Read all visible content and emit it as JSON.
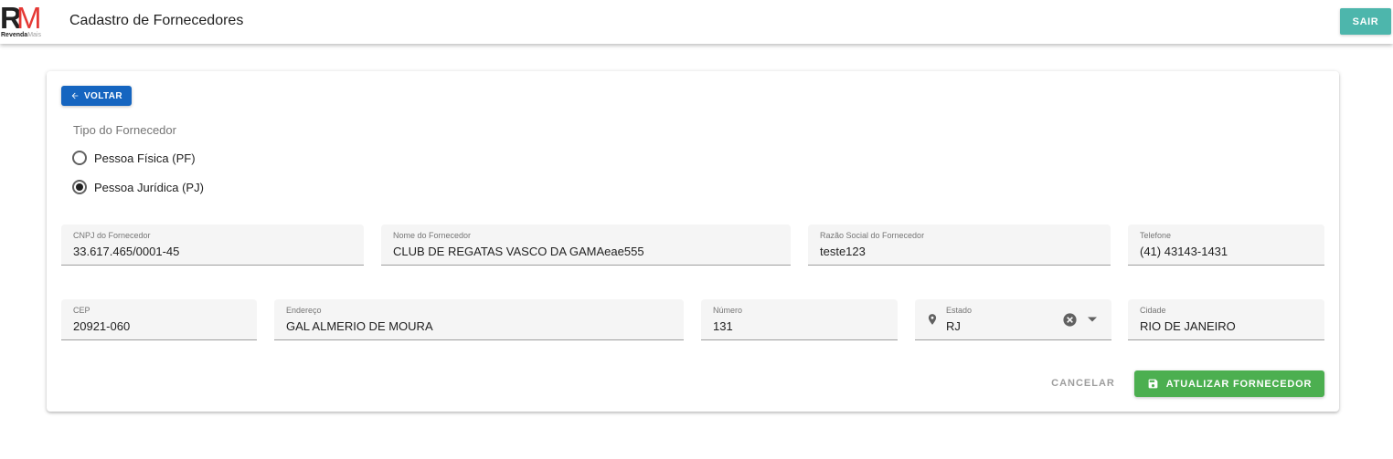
{
  "header": {
    "logo_main_r": "R",
    "logo_main_m": "M",
    "logo_sub_bold": "Revenda",
    "logo_sub_light": "Mais",
    "title": "Cadastro de Fornecedores",
    "exit_label": "SAIR"
  },
  "form": {
    "back_label": "VOLTAR",
    "tipo_label": "Tipo do Fornecedor",
    "tipo_options": [
      {
        "label": "Pessoa Física (PF)",
        "checked": false
      },
      {
        "label": "Pessoa Jurídica (PJ)",
        "checked": true
      }
    ],
    "fields": {
      "cnpj": {
        "label": "CNPJ do Fornecedor",
        "value": "33.617.465/0001-45"
      },
      "nome": {
        "label": "Nome do Fornecedor",
        "value": "CLUB DE REGATAS VASCO DA GAMAeae555"
      },
      "razao": {
        "label": "Razão Social do Fornecedor",
        "value": "teste123"
      },
      "telefone": {
        "label": "Telefone",
        "value": "(41) 43143-1431"
      },
      "cep": {
        "label": "CEP",
        "value": "20921-060"
      },
      "endereco": {
        "label": "Endereço",
        "value": "GAL ALMERIO DE MOURA"
      },
      "numero": {
        "label": "Número",
        "value": "131"
      },
      "estado": {
        "label": "Estado",
        "value": "RJ"
      },
      "cidade": {
        "label": "Cidade",
        "value": "RIO DE JANEIRO"
      }
    },
    "cancel_label": "CANCELAR",
    "update_label": "ATUALIZAR FORNECEDOR"
  },
  "icons": {
    "back": "arrow-left-icon",
    "pin": "map-marker-icon",
    "clear": "close-circle-icon",
    "caret": "chevron-down-icon",
    "save": "floppy-disk-icon"
  },
  "colors": {
    "exit_button": "#4db6ac",
    "back_button": "#1565c0",
    "update_button": "#4caf50",
    "logo_accent": "#e53935"
  }
}
